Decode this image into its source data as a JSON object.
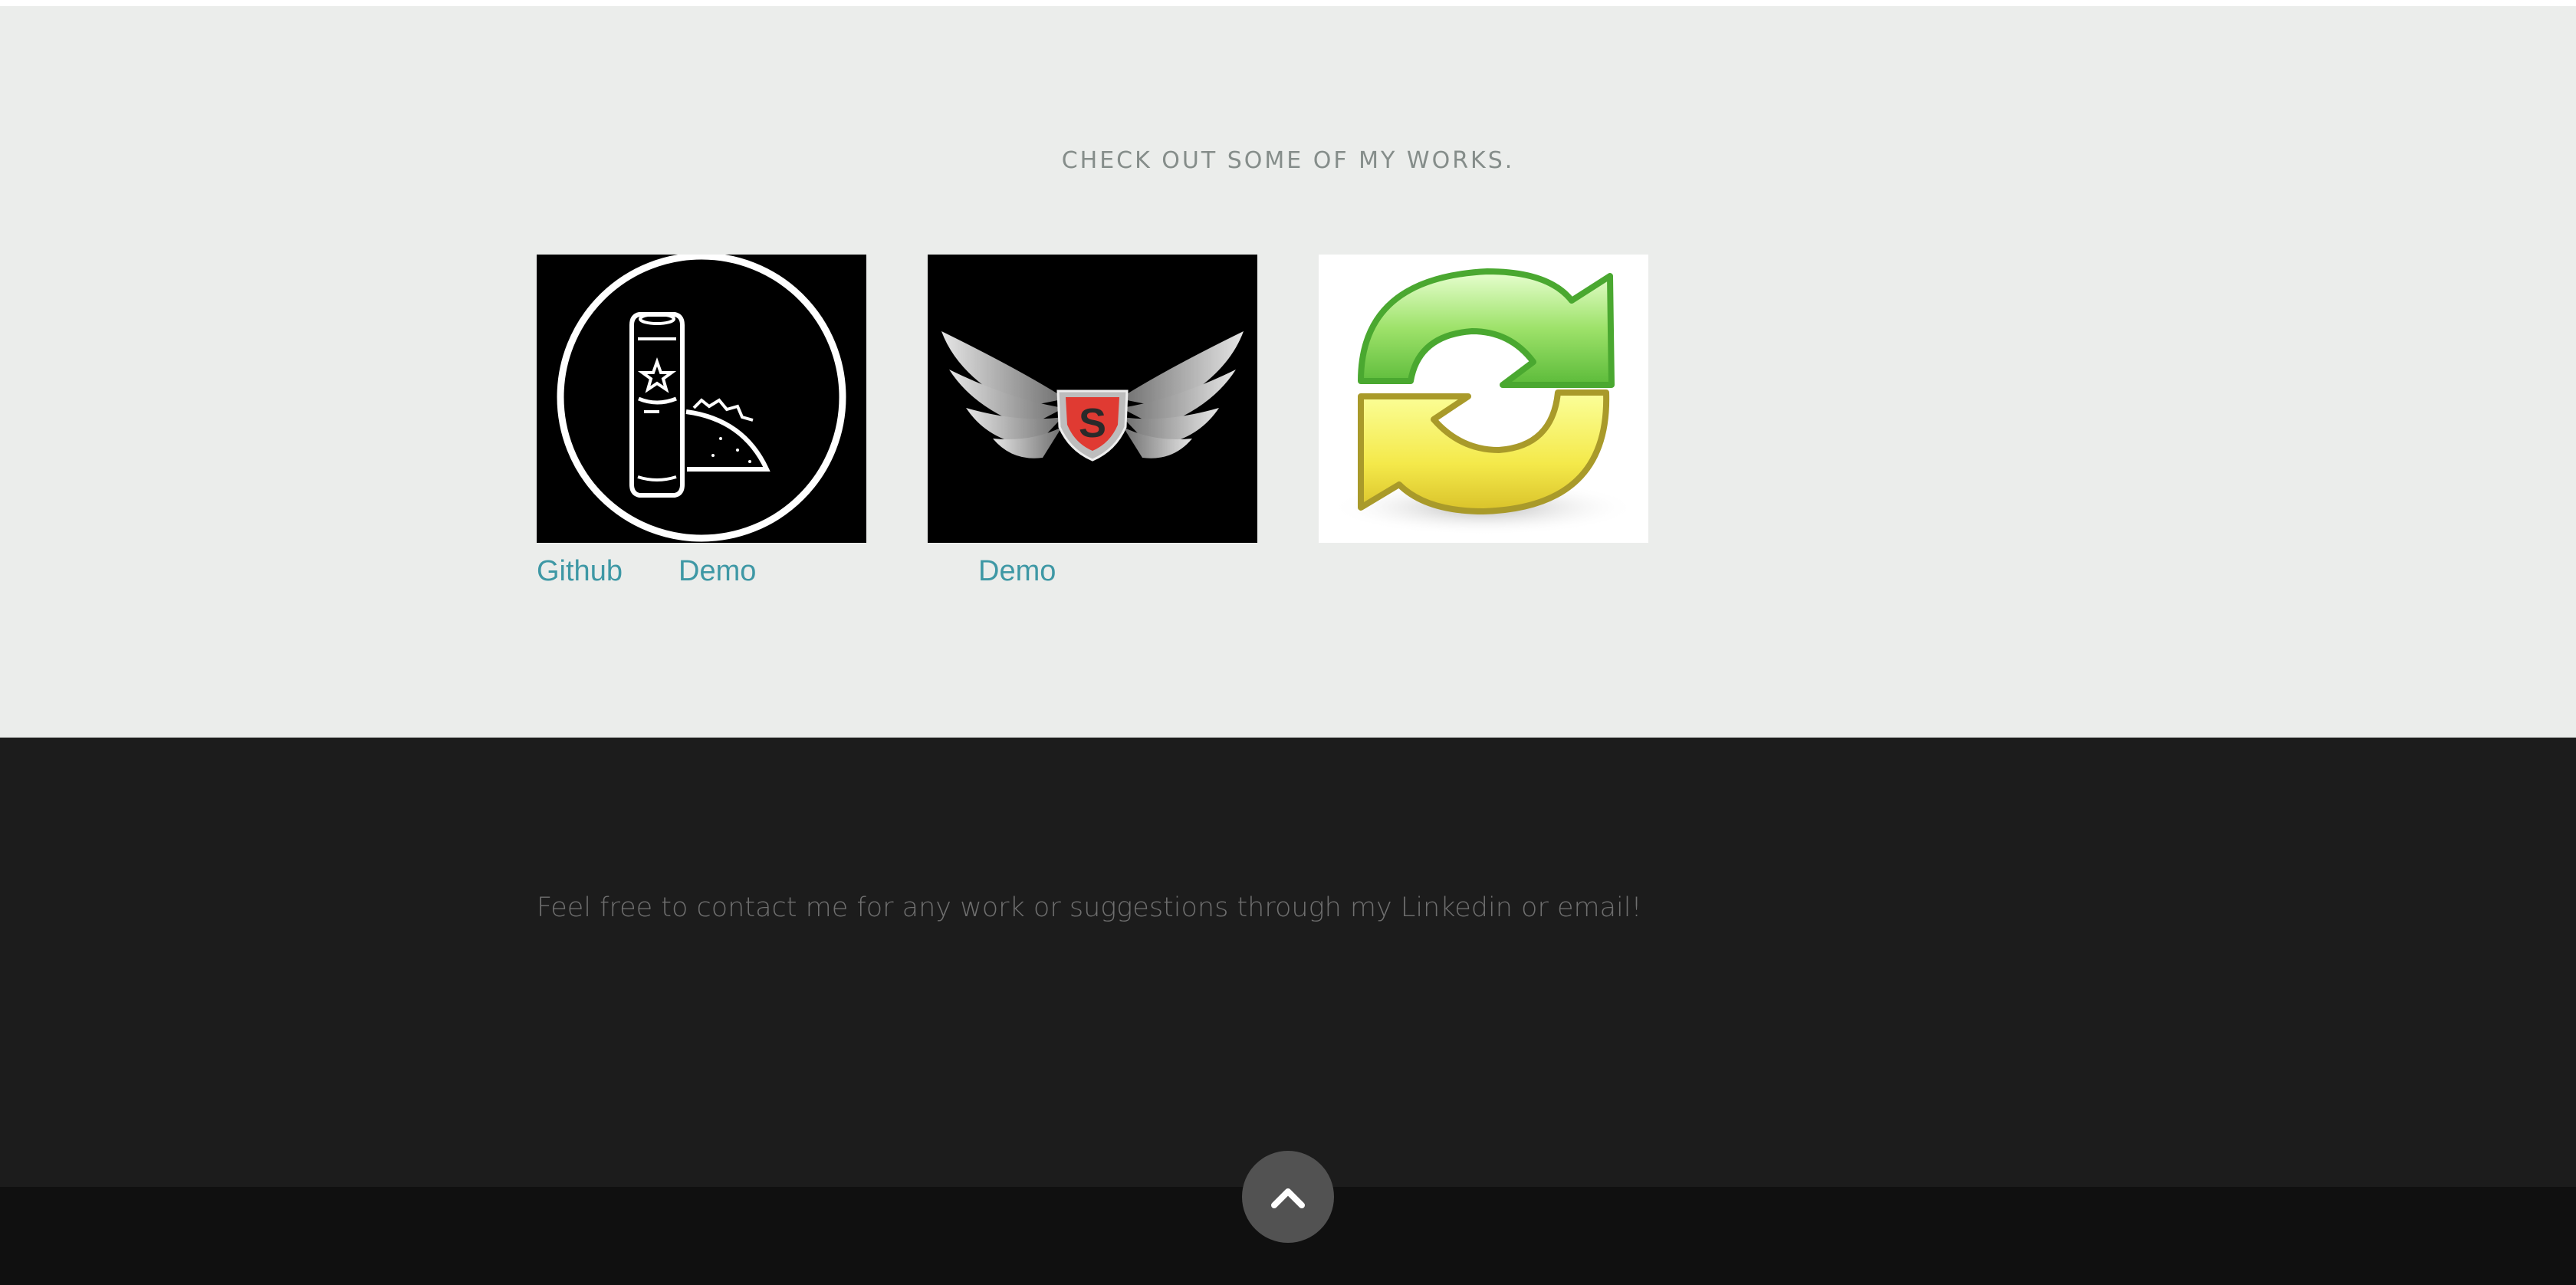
{
  "works": {
    "heading": "CHECK OUT SOME OF MY WORKS.",
    "projects": [
      {
        "image": "beer-taco-logo",
        "links": {
          "github": "Github",
          "demo": "Demo"
        }
      },
      {
        "image": "winged-shield-logo",
        "links": {
          "demo": "Demo"
        }
      },
      {
        "image": "refresh-arrows-icon",
        "links": {}
      }
    ]
  },
  "contact": {
    "text": "Feel free to contact me for any work or suggestions through my Linkedin or email!"
  },
  "footer": {
    "back_to_top_icon": "chevron-up-icon"
  },
  "colors": {
    "works_bg": "#ebedeb",
    "contact_bg": "#1c1c1c",
    "footer_bg": "#101010",
    "link": "#3e98a5",
    "heading": "#858d8a"
  }
}
